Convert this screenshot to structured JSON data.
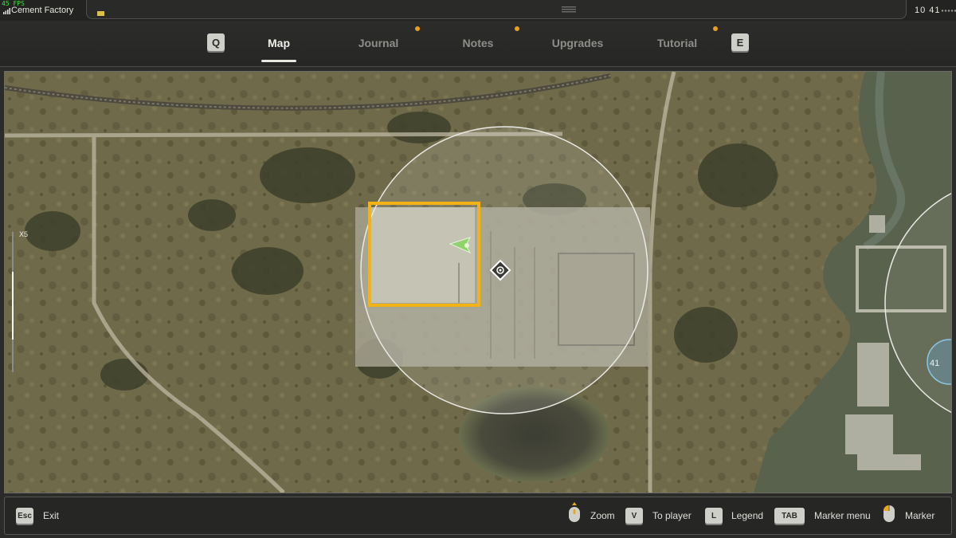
{
  "status": {
    "fps": "45 FPS",
    "location": "Cement Factory",
    "clock": "10 41"
  },
  "tabs": {
    "prev_key": "Q",
    "next_key": "E",
    "items": [
      {
        "label": "Map",
        "active": true,
        "notification": false
      },
      {
        "label": "Journal",
        "active": false,
        "notification": true
      },
      {
        "label": "Notes",
        "active": false,
        "notification": true
      },
      {
        "label": "Upgrades",
        "active": false,
        "notification": false
      },
      {
        "label": "Tutorial",
        "active": false,
        "notification": true
      }
    ]
  },
  "map": {
    "zoom_label": "X5",
    "player_marker": "player-arrow-icon",
    "objective_marker": "objective-diamond-icon",
    "highlight_color": "#f2b318",
    "player_color": "#8fd36a",
    "edge_marker_text": "41"
  },
  "controls": {
    "exit_key": "Esc",
    "exit_label": "Exit",
    "zoom_icon": "mouse-wheel-icon",
    "zoom_label": "Zoom",
    "to_player_key": "V",
    "to_player_label": "To player",
    "legend_key": "L",
    "legend_label": "Legend",
    "marker_menu_key": "TAB",
    "marker_menu_label": "Marker menu",
    "marker_icon": "mouse-left-click-icon",
    "marker_label": "Marker"
  }
}
